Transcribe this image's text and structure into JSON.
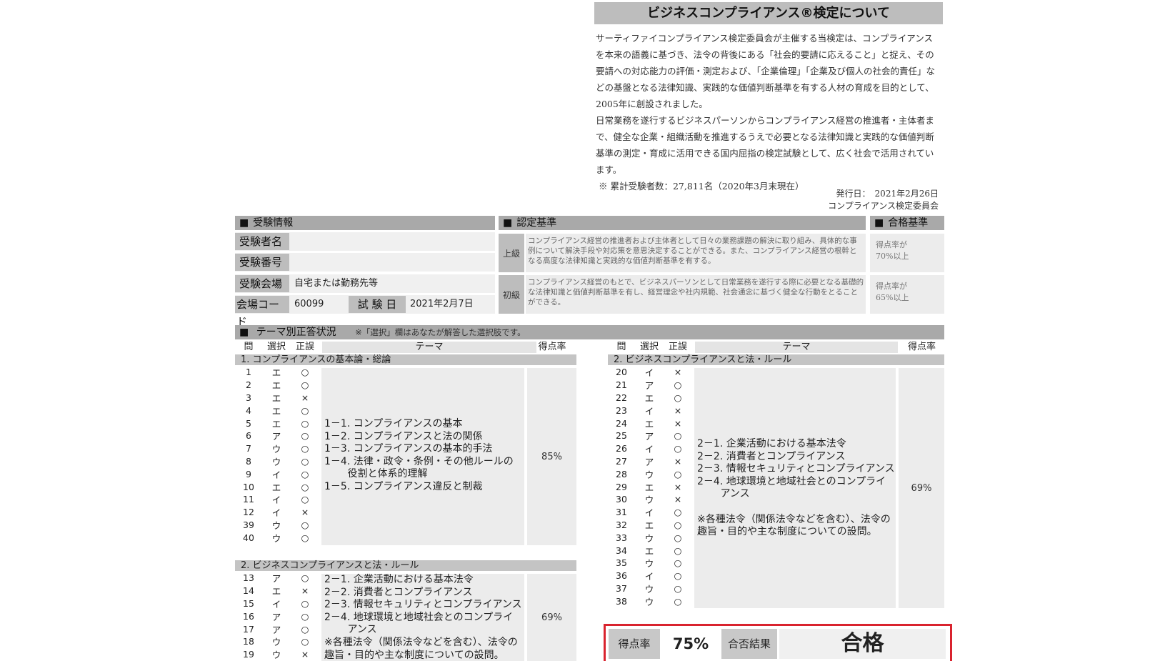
{
  "about": {
    "title": "ビジネスコンプライアンス®検定について",
    "paragraphs": [
      "サーティファイコンプライアンス検定委員会が主催する当検定は、コンプライアンスを本来の語義に基づき、法令の背後にある「社会的要請に応えること」と捉え、その要請への対応能力の評価・測定および、「企業倫理」「企業及び個人の社会的責任」などの基盤となる法律知識、実践的な価値判断基準を有する人材の育成を目的として、2005年に創設されました。",
      "日常業務を遂行するビジネスパーソンからコンプライアンス経営の推進者・主体者まで、健全な企業・組織活動を推進するうえで必要となる法律知識と実践的な価値判断基準の測定・育成に活用できる国内屈指の検定試験として、広く社会で活用されています。"
    ],
    "note": "※ 累計受験者数：27,811名（2020年3月末現在）",
    "issue_date": "発行日：　2021年2月26日",
    "committee": "コンプライアンス検定委員会"
  },
  "exam_info": {
    "header": "受験情報",
    "name_label": "受験者名",
    "name_value": "",
    "number_label": "受験番号",
    "number_value": "",
    "venue_label": "受験会場",
    "venue_value": "自宅または勤務先等",
    "code_label": "会場コード",
    "code_value": "60099",
    "date_label": "試 験 日",
    "date_value": "2021年2月7日"
  },
  "certification": {
    "header": "認定基準",
    "pass_header": "合格基準",
    "levels": [
      {
        "level": "上級",
        "description": "コンプライアンス経営の推進者および主体者として日々の業務課題の解決に取り組み、具体的な事例について解決手段や対応策を意思決定することができる。また、コンプライアンス経営の根幹となる高度な法律知識と実践的な価値判断基準を有する。",
        "pass": [
          "得点率が",
          "70%以上"
        ]
      },
      {
        "level": "初級",
        "description": "コンプライアンス経営のもとで、ビジネスパーソンとして日常業務を遂行する際に必要となる基礎的な法律知識と価値判断基準を有し、経営理念や社内規範、社会通念に基づく健全な行動をとることができる。",
        "pass": [
          "得点率が",
          "65%以上"
        ]
      }
    ]
  },
  "themes": {
    "header": "テーマ別正答状況",
    "note": "※「選択」欄はあなたが解答した選択肢です。",
    "columns": {
      "q": "問",
      "sel": "選択",
      "res": "正誤",
      "theme": "テーマ",
      "score": "得点率"
    },
    "left_groups": [
      {
        "title": "1. コンプライアンスの基本論・総論",
        "rows": [
          [
            "1",
            "エ",
            "○"
          ],
          [
            "2",
            "エ",
            "○"
          ],
          [
            "3",
            "エ",
            "×"
          ],
          [
            "4",
            "エ",
            "○"
          ],
          [
            "5",
            "エ",
            "○"
          ],
          [
            "6",
            "ア",
            "○"
          ],
          [
            "7",
            "ウ",
            "○"
          ],
          [
            "8",
            "ウ",
            "○"
          ],
          [
            "9",
            "イ",
            "○"
          ],
          [
            "10",
            "エ",
            "○"
          ],
          [
            "11",
            "イ",
            "○"
          ],
          [
            "12",
            "イ",
            "×"
          ],
          [
            "39",
            "ウ",
            "○"
          ],
          [
            "40",
            "ウ",
            "○"
          ]
        ],
        "topics": [
          "1－1. コンプライアンスの基本",
          "1－2. コンプライアンスと法の関係",
          "1－3. コンプライアンスの基本的手法",
          "1－4. 法律・政令・条例・その他ルールの",
          "　　 役割と体系的理解",
          "1－5. コンプライアンス違反と制裁"
        ],
        "score": "85%"
      },
      {
        "title": "2. ビジネスコンプライアンスと法・ルール",
        "rows": [
          [
            "13",
            "ア",
            "○"
          ],
          [
            "14",
            "エ",
            "×"
          ],
          [
            "15",
            "イ",
            "○"
          ],
          [
            "16",
            "ア",
            "○"
          ],
          [
            "17",
            "ア",
            "○"
          ],
          [
            "18",
            "ウ",
            "○"
          ],
          [
            "19",
            "ウ",
            "×"
          ]
        ],
        "topics": [
          "2－1. 企業活動における基本法令",
          "2－2. 消費者とコンプライアンス",
          "2－3. 情報セキュリティとコンプライアンス",
          "2－4. 地球環境と地域社会とのコンプライ",
          "　　 アンス",
          "※各種法令（関係法令などを含む）、法令の",
          "趣旨・目的や主な制度についての設問。"
        ],
        "score": "69%"
      }
    ],
    "right_group": {
      "title": "2. ビジネスコンプライアンスと法・ルール",
      "rows": [
        [
          "20",
          "イ",
          "×"
        ],
        [
          "21",
          "ア",
          "○"
        ],
        [
          "22",
          "エ",
          "○"
        ],
        [
          "23",
          "イ",
          "×"
        ],
        [
          "24",
          "エ",
          "×"
        ],
        [
          "25",
          "ア",
          "○"
        ],
        [
          "26",
          "イ",
          "○"
        ],
        [
          "27",
          "ア",
          "×"
        ],
        [
          "28",
          "ウ",
          "○"
        ],
        [
          "29",
          "エ",
          "×"
        ],
        [
          "30",
          "ウ",
          "×"
        ],
        [
          "31",
          "イ",
          "○"
        ],
        [
          "32",
          "エ",
          "○"
        ],
        [
          "33",
          "ウ",
          "○"
        ],
        [
          "34",
          "エ",
          "○"
        ],
        [
          "35",
          "ウ",
          "○"
        ],
        [
          "36",
          "イ",
          "○"
        ],
        [
          "37",
          "ウ",
          "○"
        ],
        [
          "38",
          "ウ",
          "○"
        ]
      ],
      "topics": [
        "2－1. 企業活動における基本法令",
        "2－2. 消費者とコンプライアンス",
        "2－3. 情報セキュリティとコンプライアンス",
        "2－4. 地球環境と地域社会とのコンプライ",
        "　　 アンス",
        "",
        "※各種法令（関係法令などを含む）、法令の",
        "趣旨・目的や主な制度についての設問。"
      ],
      "score": "69%"
    }
  },
  "result": {
    "score_label": "得点率",
    "score_value": "75%",
    "result_label": "合否結果",
    "result_value": "合格",
    "accent_color": "#d9232e"
  }
}
